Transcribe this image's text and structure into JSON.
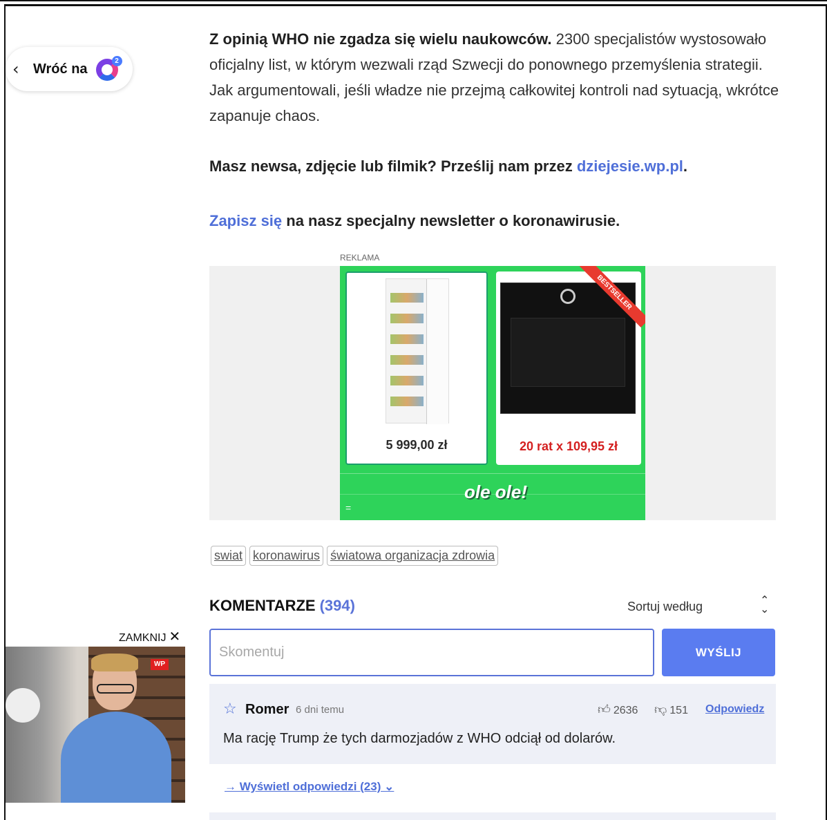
{
  "back": {
    "label": "Wróć na",
    "chevron": "‹",
    "logo_sup": "2"
  },
  "article": {
    "para_bold": "Z opinią WHO nie zgadza się wielu naukowców.",
    "para_rest": " 2300 specjalistów wystosowało oficjalny list, w którym wezwali rząd Szwecji do ponownego przemyślenia strategii. Jak argumentowali, jeśli władze nie przejmą całkowitej kontroli nad sytuacją, wkrótce zapanuje chaos.",
    "news_prefix": "Masz newsa, zdjęcie lub filmik? Prześlij nam przez ",
    "news_link": "dziejesie.wp.pl",
    "news_suffix": ".",
    "newsletter_link": "Zapisz się",
    "newsletter_rest": " na nasz specjalny newsletter o koronawirusie."
  },
  "ad": {
    "label": "REKLAMA",
    "product1_price": "5 999,00 zł",
    "product2_price": "20 rat x 109,95 zł",
    "ribbon": "BESTSELLER",
    "brand": "ole ole!",
    "menu_icon": "="
  },
  "tags": [
    "swiat",
    "koronawirus",
    "światowa organizacja zdrowia"
  ],
  "comments": {
    "title": "KOMENTARZE",
    "count": "(394)",
    "sort_label": "Sortuj według",
    "input_placeholder": "Skomentuj",
    "send_label": "WYŚLIJ",
    "items": [
      {
        "author": "Romer",
        "time": "6 dni temu",
        "likes": "2636",
        "dislikes": "151",
        "reply_label": "Odpowiedz",
        "text": "Ma rację Trump że tych darmozjadów z WHO odciął od dolarów."
      }
    ],
    "show_replies": "→ Wyświetl odpowiedzi (23) ⌄"
  },
  "video": {
    "close_label": "ZAMKNIJ",
    "close_icon": "✕",
    "badge": "WP"
  },
  "colors": {
    "accent": "#5a73d8",
    "button": "#5a7cf0",
    "ad_green": "#2ed35a",
    "price_red": "#d42020"
  }
}
